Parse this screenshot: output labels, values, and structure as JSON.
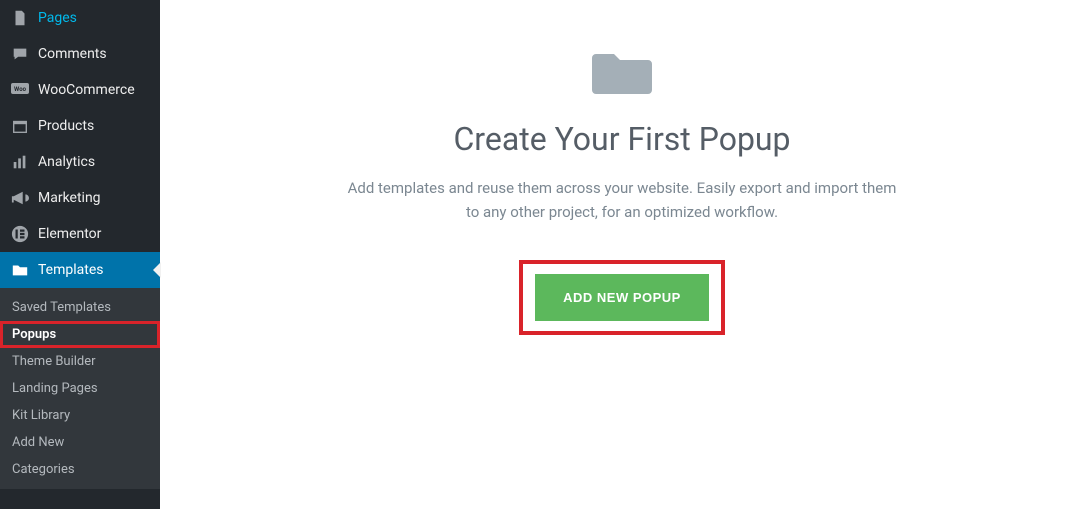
{
  "sidebar": {
    "main": [
      {
        "label": "Pages"
      },
      {
        "label": "Comments"
      },
      {
        "label": "WooCommerce"
      },
      {
        "label": "Products"
      },
      {
        "label": "Analytics"
      },
      {
        "label": "Marketing"
      },
      {
        "label": "Elementor"
      },
      {
        "label": "Templates"
      }
    ],
    "sub": [
      {
        "label": "Saved Templates"
      },
      {
        "label": "Popups"
      },
      {
        "label": "Theme Builder"
      },
      {
        "label": "Landing Pages"
      },
      {
        "label": "Kit Library"
      },
      {
        "label": "Add New"
      },
      {
        "label": "Categories"
      }
    ]
  },
  "content": {
    "title": "Create Your First Popup",
    "description": "Add templates and reuse them across your website. Easily export and import them to any other project, for an optimized workflow.",
    "button": "ADD NEW POPUP"
  }
}
